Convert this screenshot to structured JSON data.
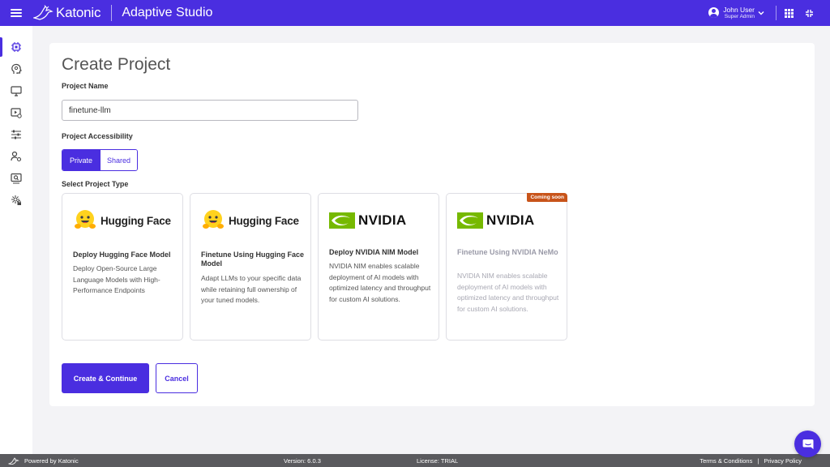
{
  "header": {
    "brand": "Katonic",
    "app_title": "Adaptive Studio",
    "user_name": "John User",
    "user_role": "Super Admin",
    "accent": "#4a2ee0"
  },
  "sidebar": {
    "items": [
      {
        "icon": "chip-icon",
        "active": true
      },
      {
        "icon": "brain-icon"
      },
      {
        "icon": "monitor-icon"
      },
      {
        "icon": "video-settings-icon"
      },
      {
        "icon": "sliders-icon"
      },
      {
        "icon": "user-settings-icon"
      },
      {
        "icon": "screen-search-icon"
      },
      {
        "icon": "gear-lock-icon"
      }
    ]
  },
  "form": {
    "title": "Create Project",
    "name_label": "Project Name",
    "name_value": "finetune-llm",
    "access_label": "Project Accessibility",
    "access_options": [
      "Private",
      "Shared"
    ],
    "access_selected": "Private",
    "type_label": "Select Project Type",
    "types": [
      {
        "logo": "Hugging Face",
        "title": "Deploy Hugging Face Model",
        "desc": "Deploy Open-Source Large Language Models with High-Performance Endpoints"
      },
      {
        "logo": "Hugging Face",
        "title": "Finetune Using Hugging Face Model",
        "desc": "Adapt LLMs to your specific data while retaining full ownership of your tuned models."
      },
      {
        "logo": "NVIDIA",
        "title": "Deploy NVIDIA NIM Model",
        "desc": "NVIDIA NIM enables scalable deployment of AI models with optimized latency and throughput for custom AI solutions."
      },
      {
        "logo": "NVIDIA",
        "title": "Finetune Using NVIDIA NeMo",
        "desc": "NVIDIA NIM enables scalable deployment of AI models with optimized latency and throughput for custom AI solutions.",
        "badge": "Coming soon",
        "disabled": true
      }
    ],
    "create_label": "Create & Continue",
    "cancel_label": "Cancel"
  },
  "footer": {
    "powered": "Powered by Katonic",
    "version": "Version: 6.0.3",
    "license": "License: TRIAL",
    "terms": "Terms & Conditions",
    "divider": "|",
    "privacy": "Privacy Policy"
  }
}
